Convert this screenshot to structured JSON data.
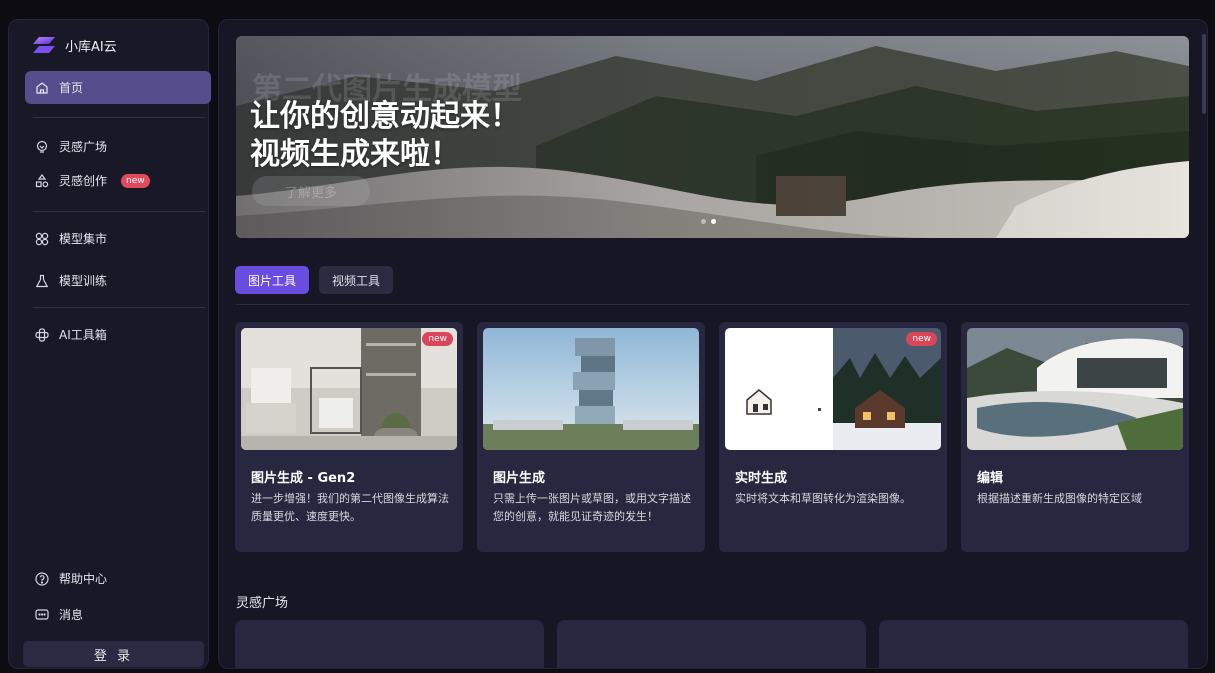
{
  "app": {
    "name": "小库AI云"
  },
  "sidebar": {
    "items": [
      {
        "label": "首页",
        "icon": "home-icon",
        "active": true
      },
      {
        "label": "灵感广场",
        "icon": "bulb-icon"
      },
      {
        "label": "灵感创作",
        "icon": "shapes-icon",
        "badge": "new"
      },
      {
        "label": "模型集市",
        "icon": "model-market-icon"
      },
      {
        "label": "模型训练",
        "icon": "flask-icon"
      },
      {
        "label": "AI工具箱",
        "icon": "toolbox-icon"
      }
    ],
    "help": {
      "label": "帮助中心",
      "icon": "help-icon"
    },
    "messages": {
      "label": "消息",
      "icon": "message-icon"
    },
    "login_label": "登 录"
  },
  "banner": {
    "ghost_title": "第二代图片生成模型",
    "title_line1": "让你的创意动起来！",
    "title_line2": "视频生成来啦！",
    "ghost_button": "了解更多"
  },
  "tabs": [
    {
      "label": "图片工具",
      "active": true
    },
    {
      "label": "视频工具",
      "active": false
    }
  ],
  "cards": [
    {
      "title": "图片生成 - Gen2",
      "desc": "进一步增强！我们的第二代图像生成算法质量更优、速度更快。",
      "badge": "new"
    },
    {
      "title": "图片生成",
      "desc": "只需上传一张图片或草图，或用文字描述您的创意，就能见证奇迹的发生！"
    },
    {
      "title": "实时生成",
      "desc": "实时将文本和草图转化为渲染图像。",
      "badge": "new"
    },
    {
      "title": "编辑",
      "desc": "根据描述重新生成图像的特定区域"
    }
  ],
  "inspiration": {
    "title": "灵感广场"
  },
  "colors": {
    "accent": "#6a4de0",
    "active_nav": "#554e8d",
    "badge": "#e04a5a"
  }
}
